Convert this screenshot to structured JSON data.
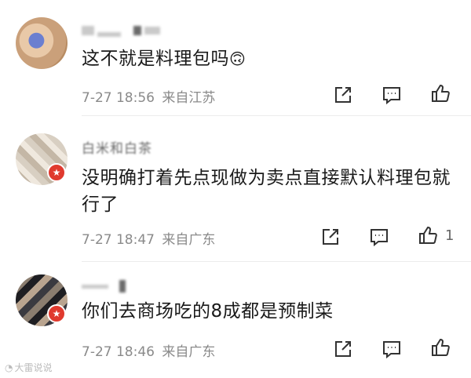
{
  "comments": [
    {
      "text": "这不就是料理包吗",
      "emoji": "🙃",
      "time": "7-27 18:56",
      "location": "来自江苏",
      "like_count": ""
    },
    {
      "username": "白米和白茶",
      "text": "没明确打着先点现做为卖点直接默认料理包就行了",
      "time": "7-27 18:47",
      "location": "来自广东",
      "like_count": "1"
    },
    {
      "text": "你们去商场吃的8成都是预制菜",
      "time": "7-27 18:46",
      "location": "来自广东",
      "like_count": ""
    }
  ],
  "watermark": "大雷说说",
  "colors": {
    "badge": "#e03a2e",
    "meta": "#8a8a8a",
    "icon": "#333333"
  }
}
